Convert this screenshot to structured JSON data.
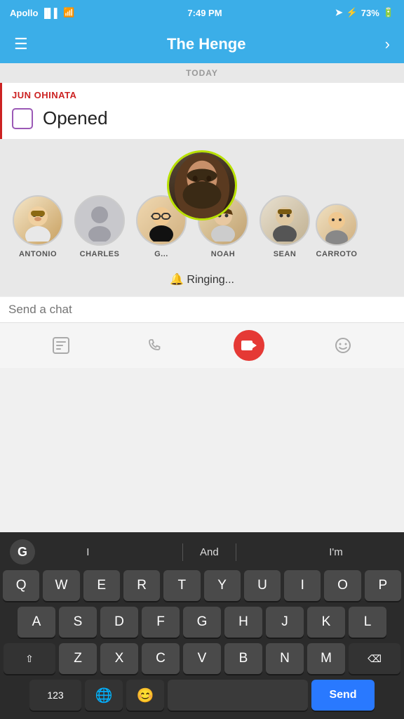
{
  "statusBar": {
    "carrier": "Apollo",
    "time": "7:49 PM",
    "battery": "73%",
    "signal": "●●●",
    "wifi": "wifi"
  },
  "navBar": {
    "title": "The Henge",
    "menuIcon": "☰",
    "nextIcon": "›"
  },
  "dateSeparator": "TODAY",
  "junBlock": {
    "name": "JUN OHINATA",
    "checkboxLabel": "Opened"
  },
  "avatars": [
    {
      "name": "ANTONIO",
      "type": "avatar",
      "emoji": "🧑"
    },
    {
      "name": "CHARLES",
      "type": "placeholder"
    },
    {
      "name": "G...",
      "type": "avatar",
      "emoji": "🧔"
    },
    {
      "name": "NOAH",
      "type": "avatar",
      "emoji": "🧑"
    },
    {
      "name": "SEAN",
      "type": "avatar",
      "emoji": "🧑"
    },
    {
      "name": "CARROTO",
      "type": "avatar",
      "emoji": "🧑"
    }
  ],
  "ringing": {
    "bellIcon": "🔔",
    "text": "Ringing..."
  },
  "chatInput": {
    "placeholder": "Send a chat"
  },
  "actionButtons": [
    {
      "name": "sticker-button",
      "icon": "📋",
      "label": "sticker"
    },
    {
      "name": "phone-button",
      "icon": "📞",
      "label": "call"
    },
    {
      "name": "video-button",
      "icon": "▶",
      "label": "video",
      "accent": true
    },
    {
      "name": "emoji-button",
      "icon": "☺",
      "label": "emoji"
    }
  ],
  "keyboard": {
    "suggestions": [
      "I",
      "And",
      "I'm"
    ],
    "rows": [
      [
        "Q",
        "W",
        "E",
        "R",
        "T",
        "Y",
        "U",
        "I",
        "O",
        "P"
      ],
      [
        "A",
        "S",
        "D",
        "F",
        "G",
        "H",
        "J",
        "K",
        "L"
      ],
      [
        "⇧",
        "Z",
        "X",
        "C",
        "V",
        "B",
        "N",
        "M",
        "⌫"
      ],
      [
        "123",
        "🌐",
        "😊",
        "space",
        "Send"
      ]
    ],
    "sendLabel": "Send",
    "gLabel": "G"
  }
}
